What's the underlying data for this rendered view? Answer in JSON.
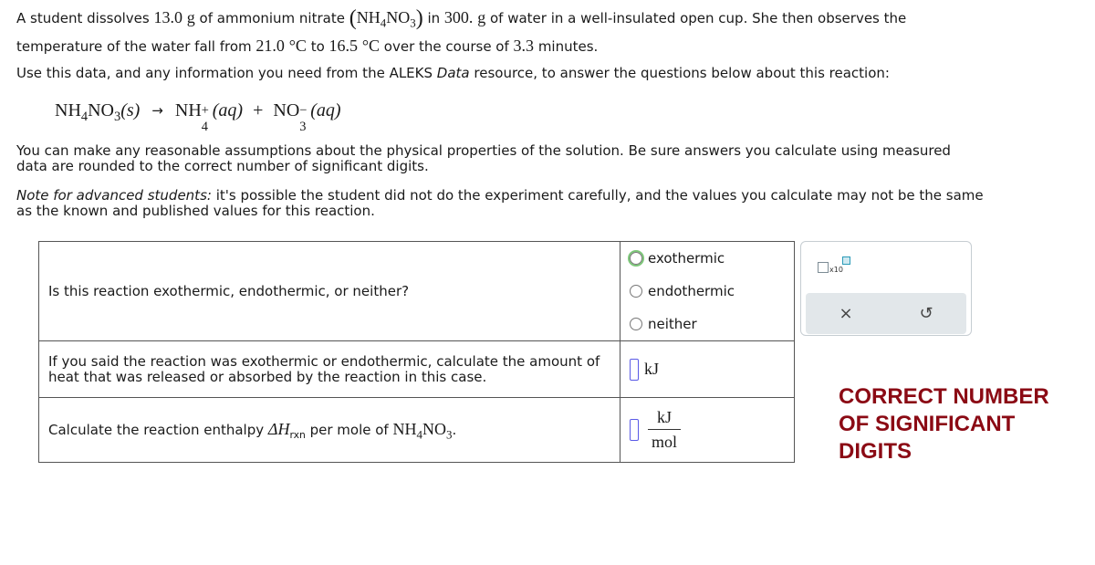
{
  "intro": {
    "p1_a": "A student dissolves ",
    "mass_solute": "13.0",
    "unit_g": "g",
    "p1_b": " of ammonium nitrate ",
    "formula_main": "NH",
    "formula_sub4": "4",
    "formula_no": "NO",
    "formula_sub3": "3",
    "p1_c": " in ",
    "mass_water": "300.",
    "p1_d": " of water in a well-insulated open cup. She then observes the",
    "p2_a": "temperature of the water fall from ",
    "t_initial": "21.0",
    "unit_c": "°C",
    "p2_b": " to ",
    "t_final": "16.5",
    "p2_c": " over the course of ",
    "time": "3.3",
    "p2_d": " minutes.",
    "line3_a": "Use this data, and any information you need from the ALEKS ",
    "line3_italic": "Data",
    "line3_b": " resource, to answer the questions below about this reaction:"
  },
  "equation": {
    "reactant": "NH",
    "r_sub4": "4",
    "r_no": "NO",
    "r_sub3": "3",
    "r_state": "(s)",
    "arrow": "→",
    "p1": "NH",
    "p1_sup": "+",
    "p1_sub": "4",
    "p1_state": "(aq)",
    "plus": "+",
    "p2": "NO",
    "p2_sup": "−",
    "p2_sub": "3",
    "p2_state": "(aq)"
  },
  "para1": "You can make any reasonable assumptions about the physical properties of the solution. Be sure answers you calculate using measured data are rounded to the correct number of significant digits.",
  "para2_italic": "Note for advanced students:",
  "para2_rest": " it's possible the student did not do the experiment carefully, and the values you calculate may not be the same as the known and published values for this reaction.",
  "questions": [
    {
      "text": "Is this reaction exothermic, endothermic, or neither?",
      "options": [
        "exothermic",
        "endothermic",
        "neither"
      ],
      "selected": null
    },
    {
      "text": "If you said the reaction was exothermic or endothermic, calculate the amount of heat that was released or absorbed by the reaction in this case.",
      "value": "",
      "unit": "kJ"
    },
    {
      "text_a": "Calculate the reaction enthalpy ",
      "delta_h": "ΔH",
      "rxn": "rxn",
      "text_b": " per mole of ",
      "nh": "NH",
      "sub4": "4",
      "no": "NO",
      "sub3": "3",
      "period": ".",
      "value": "",
      "unit_num": "kJ",
      "unit_den": "mol"
    }
  ],
  "toolbox": {
    "x10_label": "x10",
    "clear_icon": "×",
    "undo_icon": "↺"
  },
  "warning": "CORRECT NUMBER OF SIGNIFICANT DIGITS"
}
